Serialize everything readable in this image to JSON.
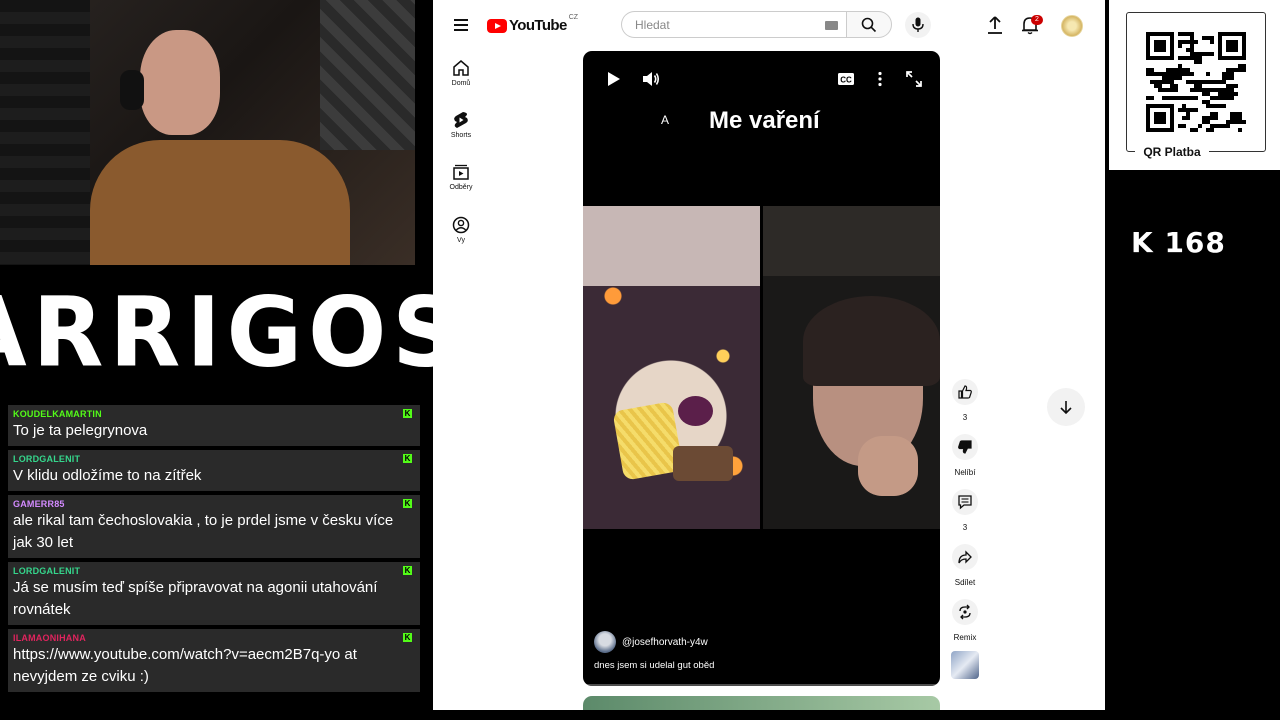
{
  "overlay": {
    "logo_text": "ARRIGOS",
    "chat": [
      {
        "user": "KOUDELKAMARTIN",
        "user_color": "#53fc18",
        "text": "To je ta pelegrynova"
      },
      {
        "user": "LORDGALENIT",
        "user_color": "#35d68c",
        "text": "V klidu odložíme to na zítřek"
      },
      {
        "user": "GAMERR85",
        "user_color": "#d38aff",
        "text": "ale rikal tam čechoslovakia , to je prdel jsme v česku více jak 30 let"
      },
      {
        "user": "LORDGALENIT",
        "user_color": "#35d68c",
        "text": "Já se musím teď spíše připravovat na agonii utahování rovnátek"
      },
      {
        "user": "ILAMAONIHANA",
        "user_color": "#e0245e",
        "text": "https://www.youtube.com/watch?v=aecm2B7q-yo at nevyjdem ze cviku :)"
      }
    ],
    "chat_badge_icon": "kick-icon",
    "qr_label": "QR Platba",
    "counter": "K  168"
  },
  "youtube": {
    "logo_word": "YouTube",
    "country": "CZ",
    "search": {
      "placeholder": "Hledat",
      "value": ""
    },
    "notifications_count": "2",
    "guide": [
      {
        "label": "Domů",
        "icon": "home-icon"
      },
      {
        "label": "Shorts",
        "icon": "shorts-icon"
      },
      {
        "label": "Odběry",
        "icon": "subscriptions-icon"
      },
      {
        "label": "Vy",
        "icon": "you-icon"
      }
    ],
    "video": {
      "letter": "A",
      "title": "Me vaření",
      "channel": "@josefhorvath-y4w",
      "description": "dnes jsem si udelal gut oběd",
      "progress": 0.0
    },
    "actions": {
      "likes": "3",
      "dislike_label": "Nelíbí",
      "comments": "3",
      "share_label": "Sdílet",
      "remix_label": "Remix"
    },
    "colors": {
      "brand_red": "#ff0000",
      "text": "#0f0f0f",
      "chip": "#f2f2f2"
    }
  }
}
